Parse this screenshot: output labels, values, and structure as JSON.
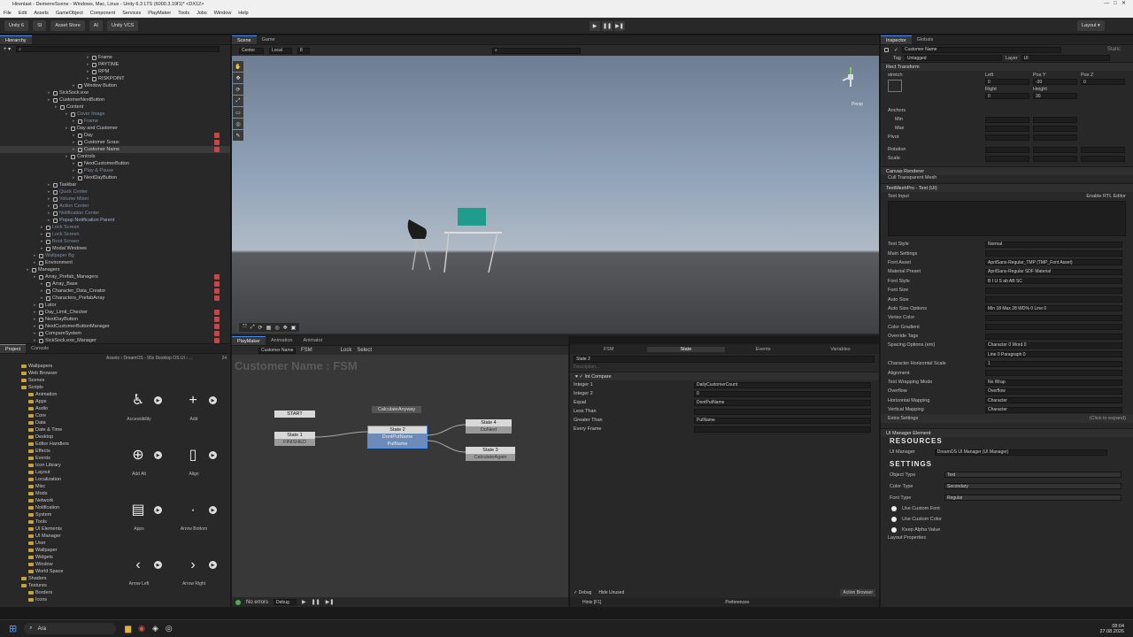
{
  "window": {
    "title": "Hirenlast - DemerreScene - Windows, Mac, Linux - Unity 6.3 LTS (6000.3.19f1)* <DX12>"
  },
  "menu": [
    "File",
    "Edit",
    "Assets",
    "GameObject",
    "Component",
    "Services",
    "PlayMaker",
    "Tools",
    "Jobs",
    "Window",
    "Help"
  ],
  "toolbar": {
    "unity": "Unity 6",
    "si": "SI",
    "asset_store": "Asset Store",
    "ai": "AI",
    "vcs": "Unity VCS",
    "layout": "Layout"
  },
  "hierarchy": {
    "tab": "Hierarchy",
    "lines": [
      {
        "t": "Frame",
        "i": 98,
        "c": ""
      },
      {
        "t": "PAYTIME",
        "i": 98,
        "c": ""
      },
      {
        "t": "RPM",
        "i": 98,
        "c": ""
      },
      {
        "t": "RISKPOINT",
        "i": 98,
        "c": ""
      },
      {
        "t": "Window Button",
        "i": 82,
        "c": ""
      },
      {
        "t": "SickSock.exe",
        "i": 54,
        "c": ""
      },
      {
        "t": "CustomerNextButton",
        "i": 54,
        "c": ""
      },
      {
        "t": "Content",
        "i": 62,
        "c": ""
      },
      {
        "t": "Cover Image",
        "i": 74,
        "c": "dim"
      },
      {
        "t": "Frame",
        "i": 82,
        "c": "dim"
      },
      {
        "t": "Day and Customer",
        "i": 74,
        "c": ""
      },
      {
        "t": "Day",
        "i": 82,
        "c": "",
        "r": 1
      },
      {
        "t": "Customer Sırası",
        "i": 82,
        "c": "",
        "r": 1
      },
      {
        "t": "Customer Name",
        "i": 82,
        "c": "sel",
        "r": 1
      },
      {
        "t": "Controls",
        "i": 74,
        "c": ""
      },
      {
        "t": "NextCustomerButton",
        "i": 82,
        "c": ""
      },
      {
        "t": "Play & Pause",
        "i": 82,
        "c": "dim"
      },
      {
        "t": "NextDayButton",
        "i": 82,
        "c": ""
      },
      {
        "t": "Taskbar",
        "i": 54,
        "c": ""
      },
      {
        "t": "Quick Center",
        "i": 54,
        "c": "dim"
      },
      {
        "t": "Volume Mixer",
        "i": 54,
        "c": "dim"
      },
      {
        "t": "Action Center",
        "i": 54,
        "c": "dim"
      },
      {
        "t": "Notification Center",
        "i": 54,
        "c": "dim"
      },
      {
        "t": "Popup Notification Parent",
        "i": 54,
        "c": "blue"
      },
      {
        "t": "Lock Screen",
        "i": 46,
        "c": "dim"
      },
      {
        "t": "Lock Screen",
        "i": 46,
        "c": "dim"
      },
      {
        "t": "Boot Screen",
        "i": 46,
        "c": "dim"
      },
      {
        "t": "Modal Windows",
        "i": 46,
        "c": ""
      },
      {
        "t": "Wallpaper Bg",
        "i": 38,
        "c": "dim"
      },
      {
        "t": "Environment",
        "i": 38,
        "c": ""
      },
      {
        "t": "Managers",
        "i": 30,
        "c": ""
      },
      {
        "t": "Array_Prefab_Managers",
        "i": 38,
        "c": "",
        "r": 1
      },
      {
        "t": "Array_Base",
        "i": 46,
        "c": "",
        "r": 1
      },
      {
        "t": "Character_Data_Creator",
        "i": 46,
        "c": "",
        "r": 1
      },
      {
        "t": "Characters_PrefabArray",
        "i": 46,
        "c": "",
        "r": 1
      },
      {
        "t": "Lator",
        "i": 38,
        "c": ""
      },
      {
        "t": "Day_Limit_Checker",
        "i": 38,
        "c": "",
        "r": 1
      },
      {
        "t": "NextDayButton",
        "i": 38,
        "c": "",
        "r": 1
      },
      {
        "t": "NextCustomerButtonManager",
        "i": 38,
        "c": "",
        "r": 1
      },
      {
        "t": "CompareSystem",
        "i": 38,
        "c": "",
        "r": 1
      },
      {
        "t": "SickSock.exe_Manager",
        "i": 38,
        "c": "",
        "r": 1
      }
    ]
  },
  "scene": {
    "tabs": [
      "Scene",
      "Game"
    ],
    "pivot": "Center",
    "space": "Local",
    "persp": "Persp",
    "num": "8"
  },
  "project": {
    "tabs": [
      "Project",
      "Console"
    ],
    "breadcrumb": "Assets › DreamOS - 90s Desktop OS UI › ...",
    "count": "24",
    "folders": [
      "Wallpapers",
      "Web Browser",
      "Scenes",
      "Scripts",
      "Animation",
      "Apps",
      "Audio",
      "Core",
      "Data",
      "Date & Time",
      "Desktop",
      "Editor Handlers",
      "Effects",
      "Events",
      "Icon Library",
      "Layout",
      "Localization",
      "Misc",
      "Mods",
      "Network",
      "Notification",
      "System",
      "Tools",
      "UI Elements",
      "UI Manager",
      "User",
      "Wallpaper",
      "Widgets",
      "Window",
      "World Space",
      "Shaders",
      "Textures",
      "Borders",
      "Icons"
    ],
    "assets": [
      {
        "label": "Accessibility",
        "icon": "accessibility-icon"
      },
      {
        "label": "Add",
        "icon": "plus-icon"
      },
      {
        "label": "Add Alt",
        "icon": "plus-circle-icon"
      },
      {
        "label": "Align",
        "icon": "align-icon"
      },
      {
        "label": "Apps",
        "icon": "apps-icon"
      },
      {
        "label": "Arrow Bottom",
        "icon": "arrow-bottom-icon"
      },
      {
        "label": "Arrow Left",
        "icon": "arrow-left-icon"
      },
      {
        "label": "Arrow Right",
        "icon": "arrow-right-icon"
      }
    ]
  },
  "fsm": {
    "tabs": [
      "PlayMaker",
      "Animation",
      "Animator"
    ],
    "selector": "Customer Name",
    "fsm_label": "FSM",
    "lock": "Lock",
    "select": "Select",
    "title": "Customer Name : FSM",
    "start": "START",
    "global_event": "CalculateAnyway",
    "states": [
      {
        "name": "State 1",
        "event": "FINISHED"
      },
      {
        "name": "State 2",
        "event": "DontPutName",
        "event2": "PutName"
      },
      {
        "name": "State 4",
        "event": "DoNext"
      },
      {
        "name": "State 3",
        "event": "CalculateAgain"
      }
    ],
    "status": {
      "errors": "No errors",
      "debug": "Debug"
    }
  },
  "state_panel": {
    "tabs": [
      "FSM",
      "State",
      "Events",
      "Variables"
    ],
    "state_name": "State 2",
    "description": "Description...",
    "action": "Int Compare",
    "rows": [
      {
        "label": "Integer 1",
        "value": "DailyCustomerCount"
      },
      {
        "label": "Integer 2",
        "value": "0"
      },
      {
        "label": "Equal",
        "value": "DontPutName"
      },
      {
        "label": "Less Than",
        "value": ""
      },
      {
        "label": "Greater Than",
        "value": "PutName"
      },
      {
        "label": "Every Frame",
        "value": ""
      }
    ],
    "footer": {
      "debug": "Debug",
      "hide": "Hide Unused",
      "browser": "Action Browser",
      "hints": "Hints [F1]",
      "prefs": "Preferences"
    }
  },
  "inspector": {
    "tabs": [
      "Inspector",
      "Globals"
    ],
    "name": "Customer Name",
    "static": "Static",
    "tag": "Untagged",
    "layer": "UI",
    "rect": "Rect Transform",
    "stretch": "stretch",
    "pos": {
      "left": "Left",
      "posy": "Pos Y",
      "posz": "Pos Z",
      "v_left": "0",
      "v_posy": "-30",
      "v_posz": "0",
      "right": "Right",
      "height": "Height",
      "v_right": "0",
      "v_height": "30"
    },
    "anchors": "Anchors",
    "min": "Min",
    "max": "Max",
    "pivot": "Pivot",
    "rotation": "Rotation",
    "scale": "Scale",
    "canvas_renderer": "Canvas Renderer",
    "cull": "Cull Transparent Mesh",
    "tmp": "TextMeshPro - Text (UI)",
    "text_input": "Text Input",
    "rtl": "Enable RTL Editor",
    "props": [
      {
        "l": "Text Style",
        "v": "Normal"
      },
      {
        "l": "Main Settings",
        "v": ""
      },
      {
        "l": "Font Asset",
        "v": "AprilSans-Regular_TMP (TMP_Font Asset)"
      },
      {
        "l": "Material Preset",
        "v": "AprilSans-Regular SDF Material"
      },
      {
        "l": "Font Style",
        "v": "B  I  U  S  ab  AB  SC"
      },
      {
        "l": "Font Size",
        "v": ""
      },
      {
        "l": "Auto Size",
        "v": ""
      },
      {
        "l": "Auto Size Options",
        "v": "Min 18   Max 28   WD% 0   Line 0"
      },
      {
        "l": "Vertex Color",
        "v": ""
      },
      {
        "l": "Color Gradient",
        "v": ""
      },
      {
        "l": "Override Tags",
        "v": ""
      },
      {
        "l": "Spacing Options (em)",
        "v": "Character 0     Word 0"
      },
      {
        "l": "",
        "v": "Line 0     Paragraph 0"
      },
      {
        "l": "Character Horizontal Scale",
        "v": "1"
      },
      {
        "l": "Alignment",
        "v": ""
      },
      {
        "l": "Text Wrapping Mode",
        "v": "No Wrap"
      },
      {
        "l": "Overflow",
        "v": "Overflow"
      },
      {
        "l": "Horizontal Mapping",
        "v": "Character"
      },
      {
        "l": "Vertical Mapping",
        "v": "Character"
      }
    ],
    "extra": "Extra Settings",
    "extra_hint": "(Click to expand)",
    "uim": "UI Manager Element",
    "resources": "RESOURCES",
    "uim_field": "UI Manager",
    "uim_value": "DreamOS UI Manager (UI Manager)",
    "settings": "SETTINGS",
    "settings_rows": [
      {
        "l": "Object Type",
        "v": "Text"
      },
      {
        "l": "Color Type",
        "v": "Secondary"
      },
      {
        "l": "Font Type",
        "v": "Regular"
      }
    ],
    "toggles": [
      "Use Custom Font",
      "Use Custom Color",
      "Keep Alpha Value"
    ],
    "layout_props": "Layout Properties"
  },
  "taskbar": {
    "search": "Ara",
    "time": "08:04",
    "date": "27.08.2026"
  }
}
